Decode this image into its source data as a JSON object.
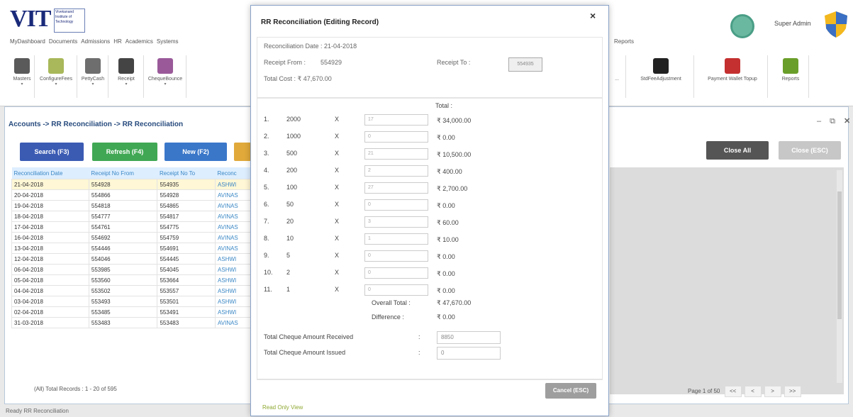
{
  "header": {
    "logo_text": "VIT",
    "logo_sub": "Vivekanand Institute of Technology",
    "menu": [
      "MyDashboard",
      "Documents",
      "Admissions",
      "HR",
      "Academics",
      "Systems"
    ],
    "menu_right": "Reports",
    "user_name": "Super Admin",
    "ribbon": [
      {
        "label": "Masters",
        "icon": "masters-icon",
        "color": "#5a5a5a"
      },
      {
        "label": "ConfigureFees",
        "icon": "config-fees-icon",
        "color": "#a8b85a"
      },
      {
        "label": "PettyCash",
        "icon": "petty-cash-icon",
        "color": "#6e6e6e"
      },
      {
        "label": "Receipt",
        "icon": "rupee-icon",
        "color": "#444444"
      },
      {
        "label": "ChequeBounce",
        "icon": "cheque-bounce-icon",
        "color": "#9a5a9a"
      }
    ],
    "ribbon_right": [
      {
        "label": "...",
        "icon": "partial-icon"
      },
      {
        "label": "StdFeeAdjustment",
        "icon": "fee-adjust-icon",
        "color": "#222222"
      },
      {
        "label": "Payment Wallet Topup",
        "icon": "wallet-topup-icon",
        "color": "#c43030"
      },
      {
        "label": "Reports",
        "icon": "reports-icon",
        "color": "#6a9e2a"
      }
    ]
  },
  "main": {
    "breadcrumb": "Accounts -> RR Reconciliation -> RR Reconciliation",
    "buttons": {
      "search": "Search (F3)",
      "refresh": "Refresh (F4)",
      "new": "New (F2)",
      "close_all": "Close All",
      "close_esc": "Close (ESC)"
    },
    "columns": [
      "Reconciliation Date",
      "Receipt No From",
      "Receipt No To",
      "Reconc"
    ],
    "rows": [
      [
        "21-04-2018",
        "554928",
        "554935",
        "ASHWI"
      ],
      [
        "20-04-2018",
        "554866",
        "554928",
        "AVINAS"
      ],
      [
        "19-04-2018",
        "554818",
        "554865",
        "AVINAS"
      ],
      [
        "18-04-2018",
        "554777",
        "554817",
        "AVINAS"
      ],
      [
        "17-04-2018",
        "554761",
        "554775",
        "AVINAS"
      ],
      [
        "16-04-2018",
        "554692",
        "554759",
        "AVINAS"
      ],
      [
        "13-04-2018",
        "554446",
        "554691",
        "AVINAS"
      ],
      [
        "12-04-2018",
        "554046",
        "554445",
        "ASHWI"
      ],
      [
        "06-04-2018",
        "553985",
        "554045",
        "ASHWI"
      ],
      [
        "05-04-2018",
        "553560",
        "553664",
        "ASHWI"
      ],
      [
        "04-04-2018",
        "553502",
        "553557",
        "ASHWI"
      ],
      [
        "03-04-2018",
        "553493",
        "553501",
        "ASHWI"
      ],
      [
        "02-04-2018",
        "553485",
        "553491",
        "ASHWI"
      ],
      [
        "31-03-2018",
        "553483",
        "553483",
        "AVINAS"
      ]
    ],
    "total_records": "(All) Total Records : 1 - 20 of 595",
    "pager": "Page 1 of 50",
    "pager_buttons": [
      "<<",
      "<",
      ">",
      ">>"
    ],
    "status": "Ready  RR Reconciliation"
  },
  "modal": {
    "title": "RR Reconciliation (Editing Record)",
    "date_label": "Reconciliation Date : 21-04-2018",
    "receipt_from_label": "Receipt From :",
    "receipt_from": "554929",
    "receipt_to_label": "Receipt To :",
    "receipt_to": "554935",
    "total_cost": "Total Cost : ₹ 47,670.00",
    "total_label": "Total :",
    "denoms": [
      {
        "n": "1.",
        "d": "2000",
        "q": "17",
        "t": "₹ 34,000.00"
      },
      {
        "n": "2.",
        "d": "1000",
        "q": "0",
        "t": "₹ 0.00"
      },
      {
        "n": "3.",
        "d": "500",
        "q": "21",
        "t": "₹ 10,500.00"
      },
      {
        "n": "4.",
        "d": "200",
        "q": "2",
        "t": "₹ 400.00"
      },
      {
        "n": "5.",
        "d": "100",
        "q": "27",
        "t": "₹ 2,700.00"
      },
      {
        "n": "6.",
        "d": "50",
        "q": "0",
        "t": "₹ 0.00"
      },
      {
        "n": "7.",
        "d": "20",
        "q": "3",
        "t": "₹ 60.00"
      },
      {
        "n": "8.",
        "d": "10",
        "q": "1",
        "t": "₹ 10.00"
      },
      {
        "n": "9.",
        "d": "5",
        "q": "0",
        "t": "₹ 0.00"
      },
      {
        "n": "10.",
        "d": "2",
        "q": "0",
        "t": "₹ 0.00"
      },
      {
        "n": "11.",
        "d": "1",
        "q": "0",
        "t": "₹ 0.00"
      }
    ],
    "x_sign": "X",
    "overall_total_label": "Overall Total :",
    "overall_total": "₹ 47,670.00",
    "difference_label": "Difference :",
    "difference": "₹ 0.00",
    "cheque_received_label": "Total Cheque Amount Received",
    "cheque_received": "8850",
    "cheque_issued_label": "Total Cheque Amount Issued",
    "cheque_issued": "0",
    "colon": ":",
    "cancel": "Cancel (ESC)",
    "read_only": "Read Only View",
    "close_glyph": "×"
  }
}
